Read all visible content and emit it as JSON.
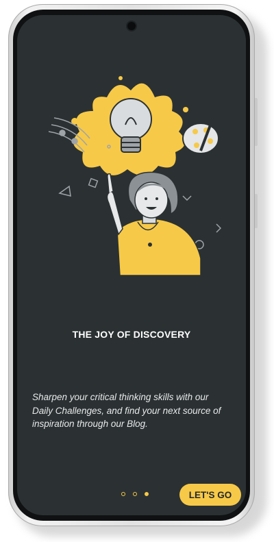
{
  "onboarding": {
    "title": "THE JOY OF DISCOVERY",
    "description": "Sharpen your critical thinking skills with our Daily Challenges, and find your next source of inspiration through our Blog.",
    "cta_label": "LET'S GO",
    "page_count": 3,
    "active_page": 3
  },
  "illustration": {
    "icons": [
      "lightbulb-icon",
      "paint-palette-icon",
      "music-notes-icon",
      "pointing-woman-figure"
    ]
  },
  "colors": {
    "screen_background": "#2b3133",
    "accent": "#f7c948",
    "text_primary": "#ffffff",
    "text_secondary": "#e8e9ea"
  }
}
